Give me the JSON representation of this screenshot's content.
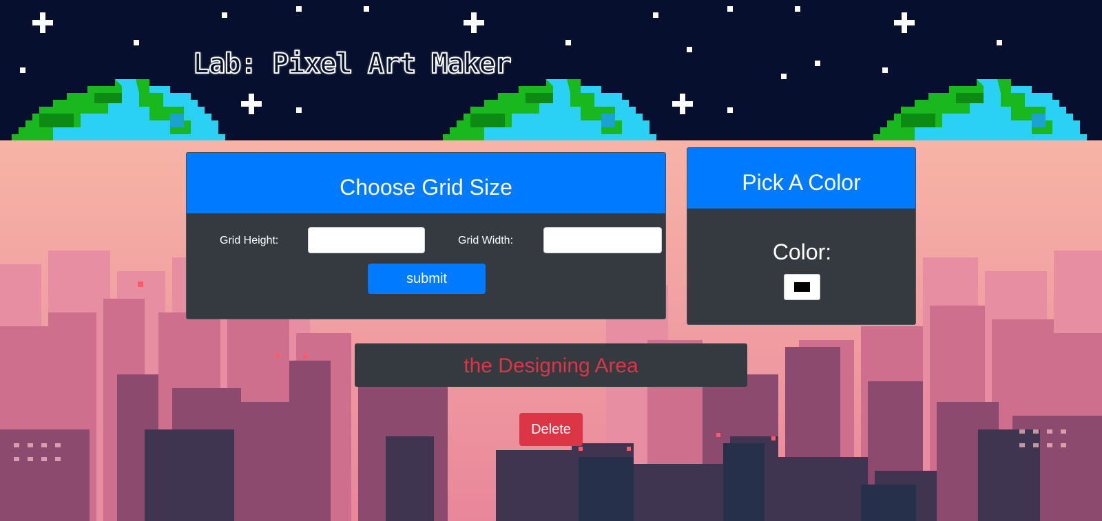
{
  "header": {
    "title": "Lab: Pixel Art Maker"
  },
  "grid_panel": {
    "title": "Choose Grid Size",
    "height_label": "Grid Height:",
    "height_value": "",
    "width_label": "Grid Width:",
    "width_value": "",
    "submit_label": "submit"
  },
  "color_panel": {
    "title": "Pick A Color",
    "color_label": "Color:",
    "color_value": "#000000"
  },
  "design_area": {
    "label": "the Designing Area"
  },
  "delete_label": "Delete",
  "colors": {
    "primary": "#007bff",
    "danger": "#dc3545",
    "panel_dark": "#343a40",
    "space": "#06102e"
  }
}
